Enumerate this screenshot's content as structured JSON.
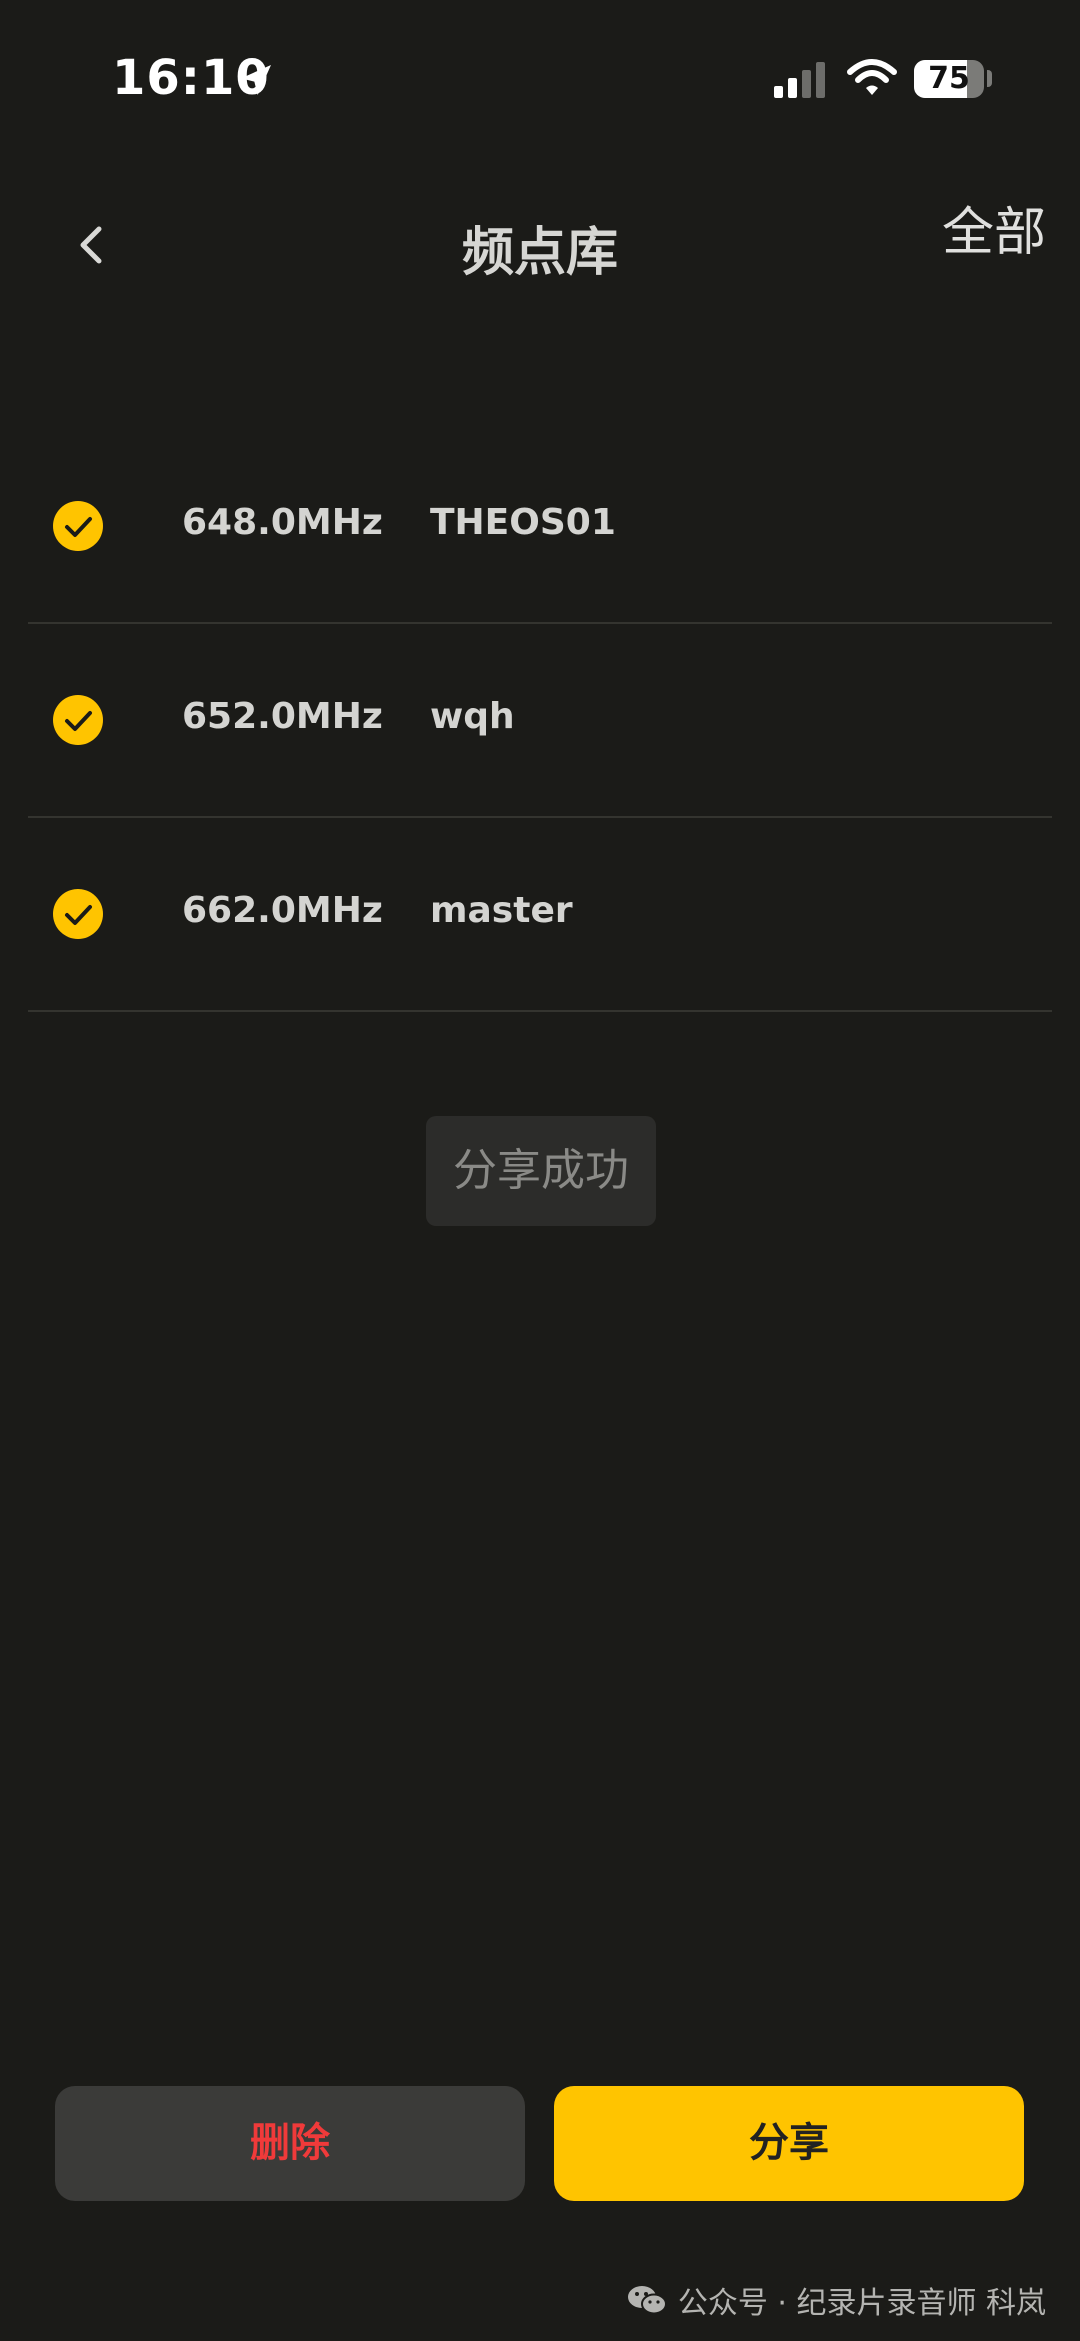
{
  "status_bar": {
    "time": "16:10",
    "battery": "75"
  },
  "header": {
    "title": "频点库",
    "select_all_label": "全部"
  },
  "frequencies": [
    {
      "value": "648.0MHz",
      "name": "THEOS01",
      "checked": true
    },
    {
      "value": "652.0MHz",
      "name": "wqh",
      "checked": true
    },
    {
      "value": "662.0MHz",
      "name": "master",
      "checked": true
    }
  ],
  "toast": {
    "message": "分享成功"
  },
  "actions": {
    "delete_label": "删除",
    "share_label": "分享"
  },
  "watermark": {
    "text": "公众号 · 纪录片录音师 科岚"
  },
  "colors": {
    "background": "#1b1b18",
    "accent": "#ffc400",
    "danger": "#f03a3a"
  }
}
